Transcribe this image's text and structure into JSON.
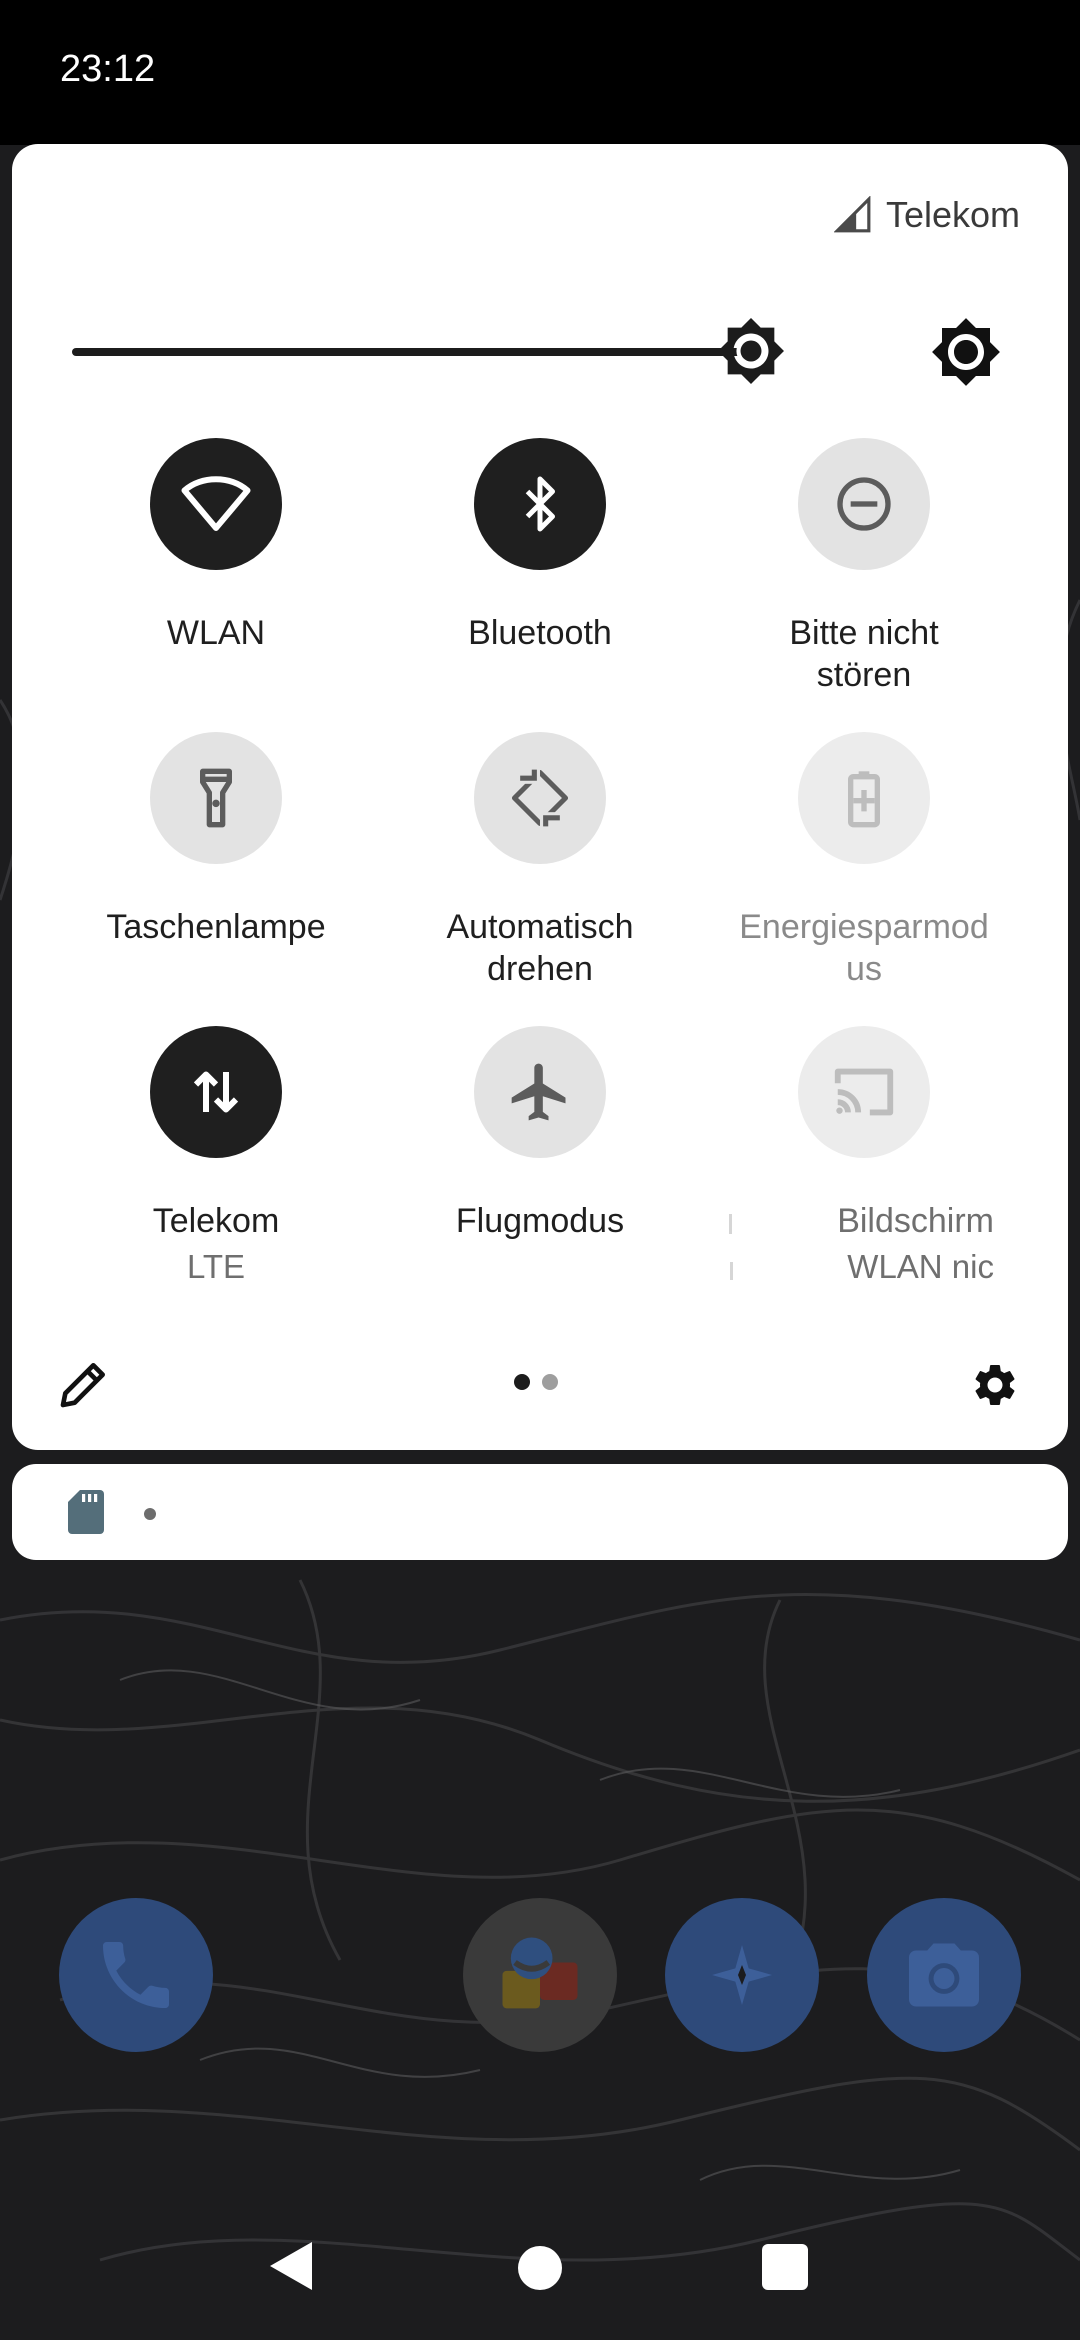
{
  "status_bar": {
    "time": "23:12"
  },
  "quick_settings": {
    "carrier": "Telekom",
    "brightness": {
      "level": 0.86,
      "auto_icon": "brightness-auto-icon"
    },
    "tiles": [
      {
        "label": "WLAN",
        "icon": "wifi-icon",
        "state": "on"
      },
      {
        "label": "Bluetooth",
        "icon": "bluetooth-icon",
        "state": "on"
      },
      {
        "label": "Bitte nicht\nstören",
        "icon": "do-not-disturb-icon",
        "state": "off"
      },
      {
        "label": "Taschenlampe",
        "icon": "flashlight-icon",
        "state": "off"
      },
      {
        "label": "Automatisch\ndrehen",
        "icon": "auto-rotate-icon",
        "state": "off"
      },
      {
        "label": "Energiesparmod\nus",
        "icon": "battery-saver-icon",
        "state": "disabled"
      },
      {
        "label": "Telekom",
        "sublabel": "LTE",
        "icon": "mobile-data-icon",
        "state": "on"
      },
      {
        "label": "Flugmodus",
        "icon": "airplane-icon",
        "state": "off"
      },
      {
        "label": "Bildschirm",
        "sublabel": "WLAN nic",
        "icon": "cast-icon",
        "state": "disabled"
      }
    ],
    "pages": {
      "count": 2,
      "current": 1
    }
  },
  "notification": {
    "icon": "sd-card-icon"
  },
  "dock": [
    {
      "icon": "phone-icon"
    },
    {
      "icon": "messages-icon"
    },
    {
      "icon": "compass-icon"
    },
    {
      "icon": "camera-icon"
    }
  ],
  "colors": {
    "tile_on": "#1f1f1f",
    "tile_off": "#e3e3e3",
    "panel": "#ffffff",
    "dock": "#2e4a7a"
  }
}
